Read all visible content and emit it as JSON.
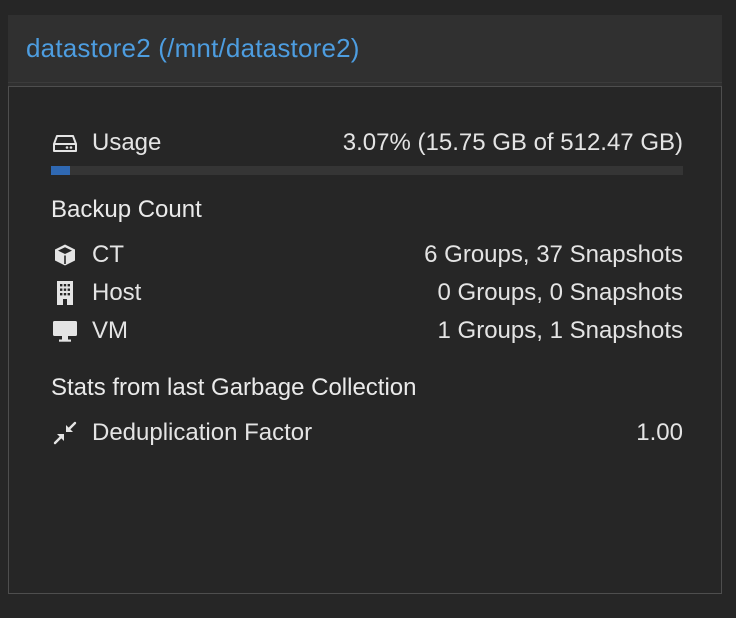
{
  "panel": {
    "title": "datastore2 (/mnt/datastore2)"
  },
  "usage": {
    "label": "Usage",
    "text": "3.07% (15.75 GB of 512.47 GB)",
    "fraction": 0.0307,
    "bar_color": "#2f68b2"
  },
  "backup_count": {
    "title": "Backup Count",
    "rows": [
      {
        "icon": "cube-icon",
        "label": "CT",
        "value": "6 Groups, 37 Snapshots"
      },
      {
        "icon": "building-icon",
        "label": "Host",
        "value": "0 Groups, 0 Snapshots"
      },
      {
        "icon": "desktop-icon",
        "label": "VM",
        "value": "1 Groups, 1 Snapshots"
      }
    ]
  },
  "gc_stats": {
    "title": "Stats from last Garbage Collection",
    "rows": [
      {
        "icon": "compress-icon",
        "label": "Deduplication Factor",
        "value": "1.00"
      }
    ]
  },
  "colors": {
    "title": "#4d9de0",
    "background": "#262626",
    "header": "#303030"
  }
}
